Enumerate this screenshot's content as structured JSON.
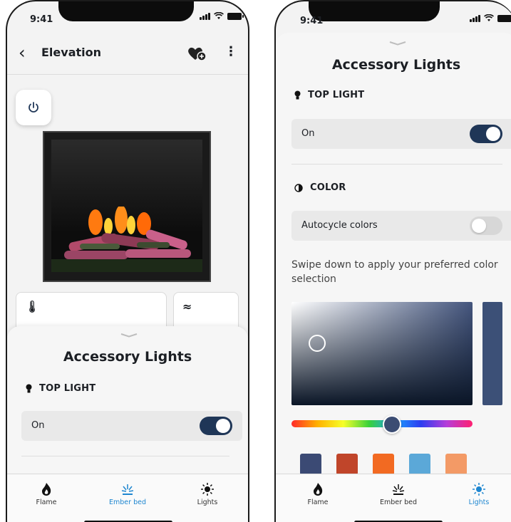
{
  "status": {
    "time": "9:41"
  },
  "phone1": {
    "title": "Elevation",
    "sheet": {
      "title": "Accessory Lights",
      "section": "TOP LIGHT",
      "row_label": "On"
    }
  },
  "phone2": {
    "sheet": {
      "title": "Accessory Lights",
      "top_light": {
        "section": "TOP LIGHT",
        "row_label": "On",
        "toggle_on": true
      },
      "color": {
        "section": "COLOR",
        "autocycle_label": "Autocycle colors",
        "autocycle_on": false,
        "helper": "Swipe down to apply your preferred color selection",
        "selected_color": "#3c5077",
        "swatches": [
          "#3b4a74",
          "#c0452a",
          "#f26a22",
          "#5ba8d8",
          "#f39a66"
        ]
      }
    }
  },
  "tabs": [
    {
      "label": "Flame",
      "icon": "flame-icon"
    },
    {
      "label": "Ember bed",
      "icon": "ember-bed-icon"
    },
    {
      "label": "Lights",
      "icon": "lights-icon"
    }
  ],
  "phone1_active_tab": "Ember bed",
  "phone2_active_tab": "Lights",
  "colors": {
    "accent": "#1e86d0",
    "toggle_on": "#1f3657"
  }
}
